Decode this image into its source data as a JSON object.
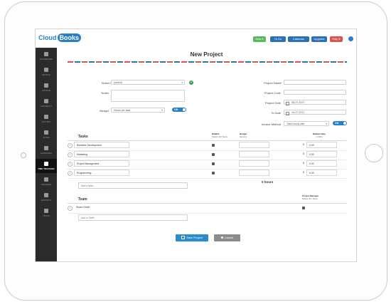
{
  "app": {
    "logo_cloud": "Cloud",
    "logo_books": "Books"
  },
  "topbar": {
    "buttons": [
      {
        "label": "New  ▾",
        "color": "#5cb85c"
      },
      {
        "label": "To Do",
        "color": "#2a6fb7"
      },
      {
        "label": "Calendar",
        "color": "#2a6fb7"
      },
      {
        "label": "Upgrade",
        "color": "#2a6fb7"
      },
      {
        "label": "Help ▾",
        "color": "#d9534f"
      }
    ],
    "settings_icon": "gear-icon"
  },
  "sidebar": {
    "items": [
      {
        "label": "DASHBOARD",
        "icon": "dashboard-icon"
      },
      {
        "label": "PEOPLE",
        "icon": "people-icon"
      },
      {
        "label": "INVOICE",
        "icon": "invoice-icon"
      },
      {
        "label": "CONTRACT",
        "icon": "contract-icon"
      },
      {
        "label": "QUOTES",
        "icon": "quotes-icon"
      },
      {
        "label": "TAXES",
        "icon": "taxes-icon"
      },
      {
        "label": "EXPENSES",
        "icon": "expenses-icon"
      },
      {
        "label": "TIME TRACKING",
        "icon": "hourglass-icon",
        "active": true
      },
      {
        "label": "VENDORS",
        "icon": "vendors-icon"
      },
      {
        "label": "REPORTS",
        "icon": "reports-icon"
      },
      {
        "label": "TRASH",
        "icon": "trash-icon"
      }
    ]
  },
  "page": {
    "title": "New Project"
  },
  "form": {
    "select_client_label": "Select Client",
    "select_client_value": "(select)",
    "notes_label": "Notes",
    "budget_label": "Budget",
    "budget_value": "Hours per task",
    "budget_toggle": "ON",
    "project_name_label": "Project Name",
    "project_code_label": "Project Code",
    "project_date_label": "Project Date",
    "project_date_value": "08-27-2017",
    "to_date_label": "To Date",
    "to_date_value": "10-27-2017",
    "invoice_method_label": "Invoice Method",
    "invoice_method_value": "Task hourly rate",
    "invoice_toggle": "ON"
  },
  "tasks": {
    "section_title": "Tasks",
    "col_billable": "Billable",
    "col_billable_sub": "Select All / None",
    "col_budget": "Budget",
    "col_budget_sub": "(Hours)",
    "col_rate": "Billable Rate",
    "col_rate_sub": "( US$ )",
    "rows": [
      {
        "name": "Business Development",
        "billable": true,
        "currency": "$",
        "rate": "0.00"
      },
      {
        "name": "Marketing",
        "billable": true,
        "currency": "$",
        "rate": "0.00"
      },
      {
        "name": "Project Management",
        "billable": true,
        "currency": "$",
        "rate": "0.00"
      },
      {
        "name": "Programming",
        "billable": true,
        "currency": "$",
        "rate": "0.00"
      }
    ],
    "add_placeholder": "Add a task...",
    "total": "0 hours"
  },
  "team": {
    "section_title": "Team",
    "col_pm": "Project Manager",
    "col_pm_sub": "Select All / None",
    "rows": [
      {
        "name": "Shami Sheth",
        "pm": true
      }
    ],
    "add_placeholder": "Add a Staff..."
  },
  "actions": {
    "save_label": "Save Project",
    "cancel_label": "Cancel",
    "save_color": "#2a8bd0",
    "cancel_color": "#8c8c8c"
  }
}
